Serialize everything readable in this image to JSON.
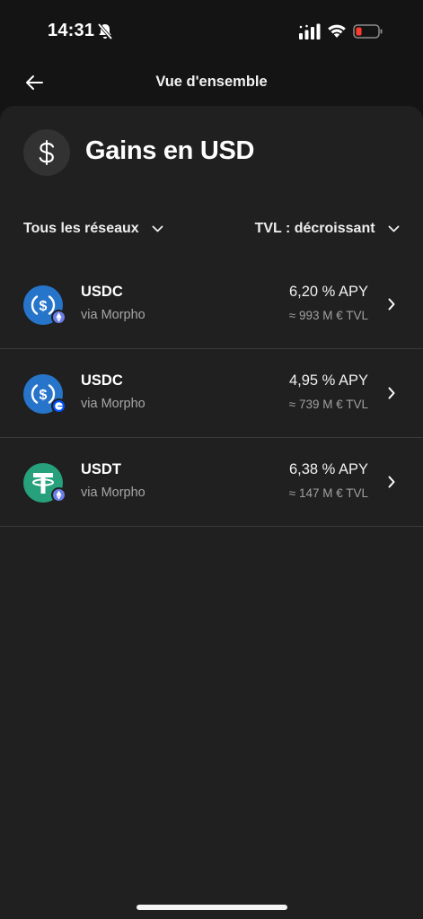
{
  "status_bar": {
    "time": "14:31"
  },
  "nav": {
    "title": "Vue d'ensemble"
  },
  "header": {
    "title": "Gains en USD",
    "icon": "dollar-icon"
  },
  "filters": {
    "networks_label": "Tous les réseaux",
    "sort_label": "TVL : décroissant"
  },
  "assets": [
    {
      "name": "USDC",
      "via": "via Morpho",
      "apy": "6,20 % APY",
      "tvl": "≈ 993 M € TVL",
      "token_icon": "usdc-icon",
      "chain_icon": "ethereum-icon",
      "token_color": "#2775CA",
      "badge_color": "#6B7FE6"
    },
    {
      "name": "USDC",
      "via": "via Morpho",
      "apy": "4,95 % APY",
      "tvl": "≈ 739 M € TVL",
      "token_icon": "usdc-icon",
      "chain_icon": "base-icon",
      "token_color": "#2775CA",
      "badge_color": "#0052FF"
    },
    {
      "name": "USDT",
      "via": "via Morpho",
      "apy": "6,38 % APY",
      "tvl": "≈ 147 M € TVL",
      "token_icon": "tether-icon",
      "chain_icon": "ethereum-icon",
      "token_color": "#26A17B",
      "badge_color": "#6B7FE6"
    }
  ]
}
